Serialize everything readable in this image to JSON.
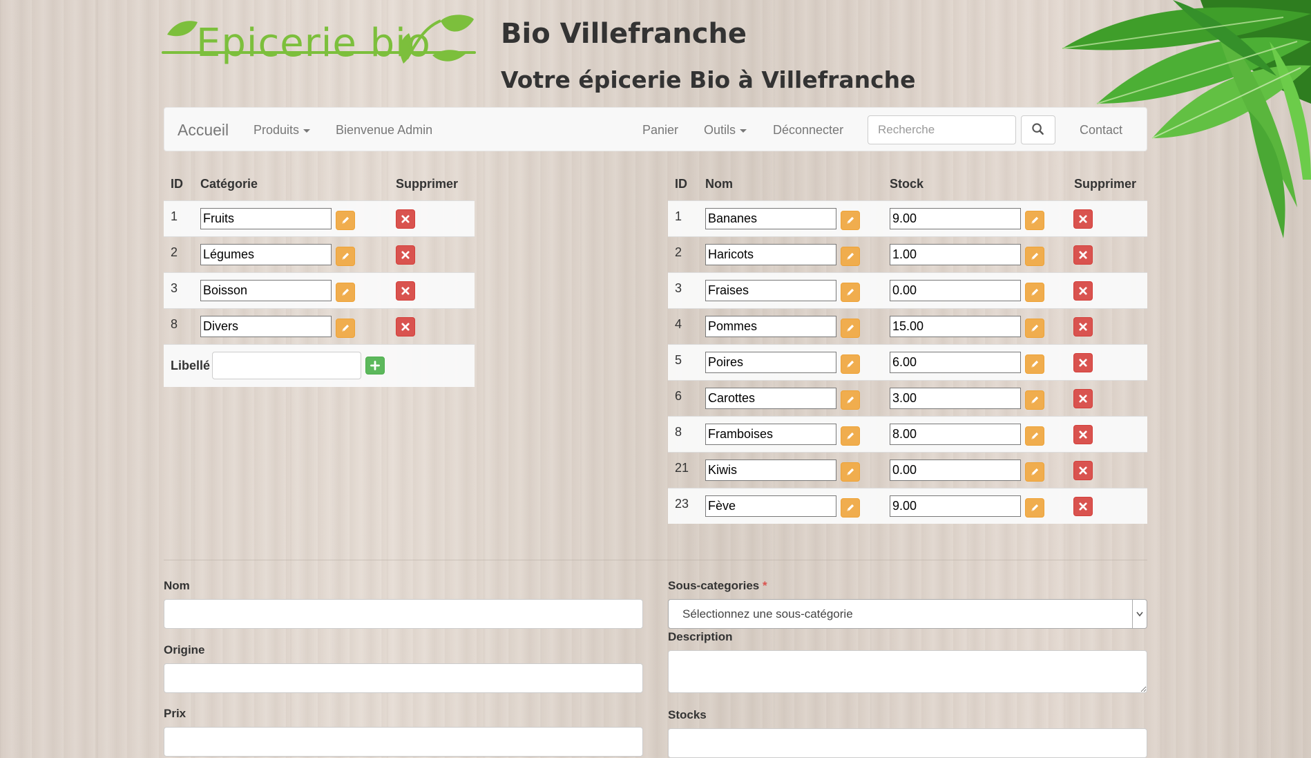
{
  "header": {
    "logo_text": "Epicerie bio",
    "title": "Bio Villefranche",
    "subtitle": "Votre épicerie Bio à Villefranche"
  },
  "navbar": {
    "brand": "Accueil",
    "produits": "Produits",
    "welcome": "Bienvenue Admin",
    "panier": "Panier",
    "outils": "Outils",
    "deconnecter": "Déconnecter",
    "search_placeholder": "Recherche",
    "contact": "Contact"
  },
  "categories_table": {
    "headers": {
      "id": "ID",
      "categorie": "Catégorie",
      "supprimer": "Supprimer"
    },
    "rows": [
      {
        "id": "1",
        "name": "Fruits"
      },
      {
        "id": "2",
        "name": "Légumes"
      },
      {
        "id": "3",
        "name": "Boisson"
      },
      {
        "id": "8",
        "name": "Divers"
      }
    ],
    "add_label": "Libellé",
    "add_value": ""
  },
  "products_table": {
    "headers": {
      "id": "ID",
      "nom": "Nom",
      "stock": "Stock",
      "supprimer": "Supprimer"
    },
    "rows": [
      {
        "id": "1",
        "name": "Bananes",
        "stock": "9.00"
      },
      {
        "id": "2",
        "name": "Haricots",
        "stock": "1.00"
      },
      {
        "id": "3",
        "name": "Fraises",
        "stock": "0.00"
      },
      {
        "id": "4",
        "name": "Pommes",
        "stock": "15.00"
      },
      {
        "id": "5",
        "name": "Poires",
        "stock": "6.00"
      },
      {
        "id": "6",
        "name": "Carottes",
        "stock": "3.00"
      },
      {
        "id": "8",
        "name": "Framboises",
        "stock": "8.00"
      },
      {
        "id": "21",
        "name": "Kiwis",
        "stock": "0.00"
      },
      {
        "id": "23",
        "name": "Fève",
        "stock": "9.00"
      }
    ]
  },
  "product_form": {
    "nom_label": "Nom",
    "nom_value": "",
    "origine_label": "Origine",
    "origine_value": "",
    "prix_label": "Prix",
    "prix_value": "",
    "souscat_label": "Sous-categories",
    "required_mark": "*",
    "souscat_selected": "Sélectionnez une sous-catégorie",
    "description_label": "Description",
    "description_value": "",
    "stocks_label": "Stocks",
    "stocks_value": ""
  },
  "colors": {
    "brand_green": "#7cbf3c",
    "edit_orange": "#f0ad4e",
    "delete_red": "#d9534f",
    "add_green": "#5cb85c"
  },
  "icons": {
    "edit": "pencil-icon",
    "delete": "remove-icon",
    "add": "plus-icon",
    "search": "search-icon"
  }
}
